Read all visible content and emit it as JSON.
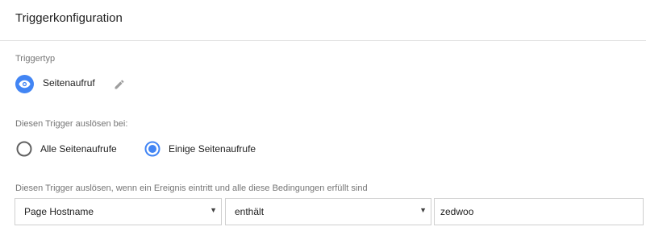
{
  "header": {
    "title": "Triggerkonfiguration"
  },
  "trigger_type": {
    "label": "Triggertyp",
    "name": "Seitenaufruf",
    "icon": "eye-icon",
    "accent_color": "#4285f4"
  },
  "fire_on": {
    "label": "Diesen Trigger auslösen bei:",
    "options": [
      {
        "label": "Alle Seitenaufrufe",
        "selected": false
      },
      {
        "label": "Einige Seitenaufrufe",
        "selected": true
      }
    ]
  },
  "conditions": {
    "label": "Diesen Trigger auslösen, wenn ein Ereignis eintritt und alle diese Bedingungen erfüllt sind",
    "variable": "Page Hostname",
    "operator": "enthält",
    "value": "zedwoo"
  }
}
